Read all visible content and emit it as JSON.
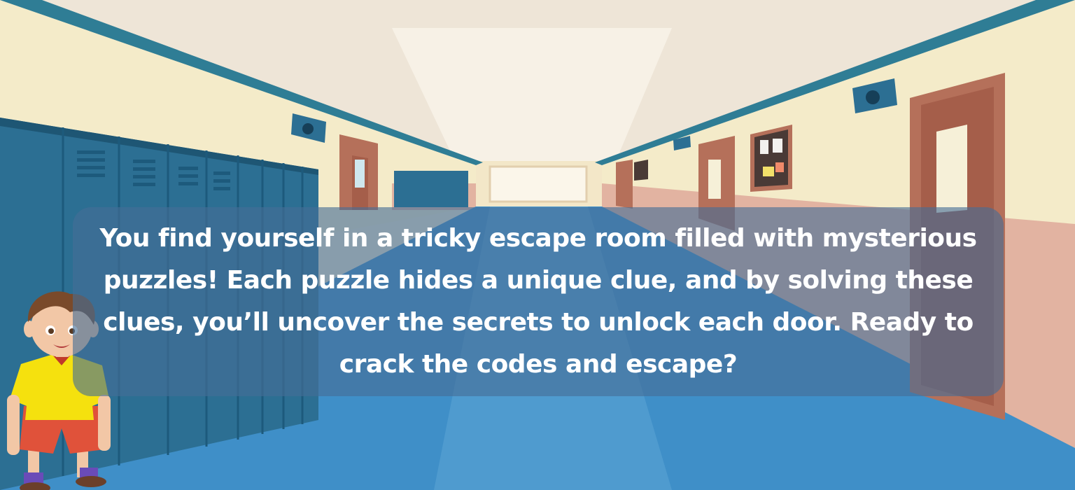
{
  "intro": {
    "text": "You find yourself in a tricky escape room filled with mysterious puzzles! Each puzzle hides a unique clue, and by solving these clues, you’ll uncover the secrets to unlock each door. Ready to crack the codes and escape?"
  },
  "scene": {
    "setting": "school-hallway",
    "colors": {
      "wall": "#f3ead0",
      "ceiling": "#efe6d6",
      "floor": "#3d8fc7",
      "lockers": "#2f6f93",
      "door": "#b5705a",
      "trim": "#2f7d95",
      "panel": "#466e96"
    }
  },
  "character": {
    "icon": "boy-student-icon",
    "shirt_color": "#f5e10e",
    "shorts_color": "#e0523a"
  }
}
